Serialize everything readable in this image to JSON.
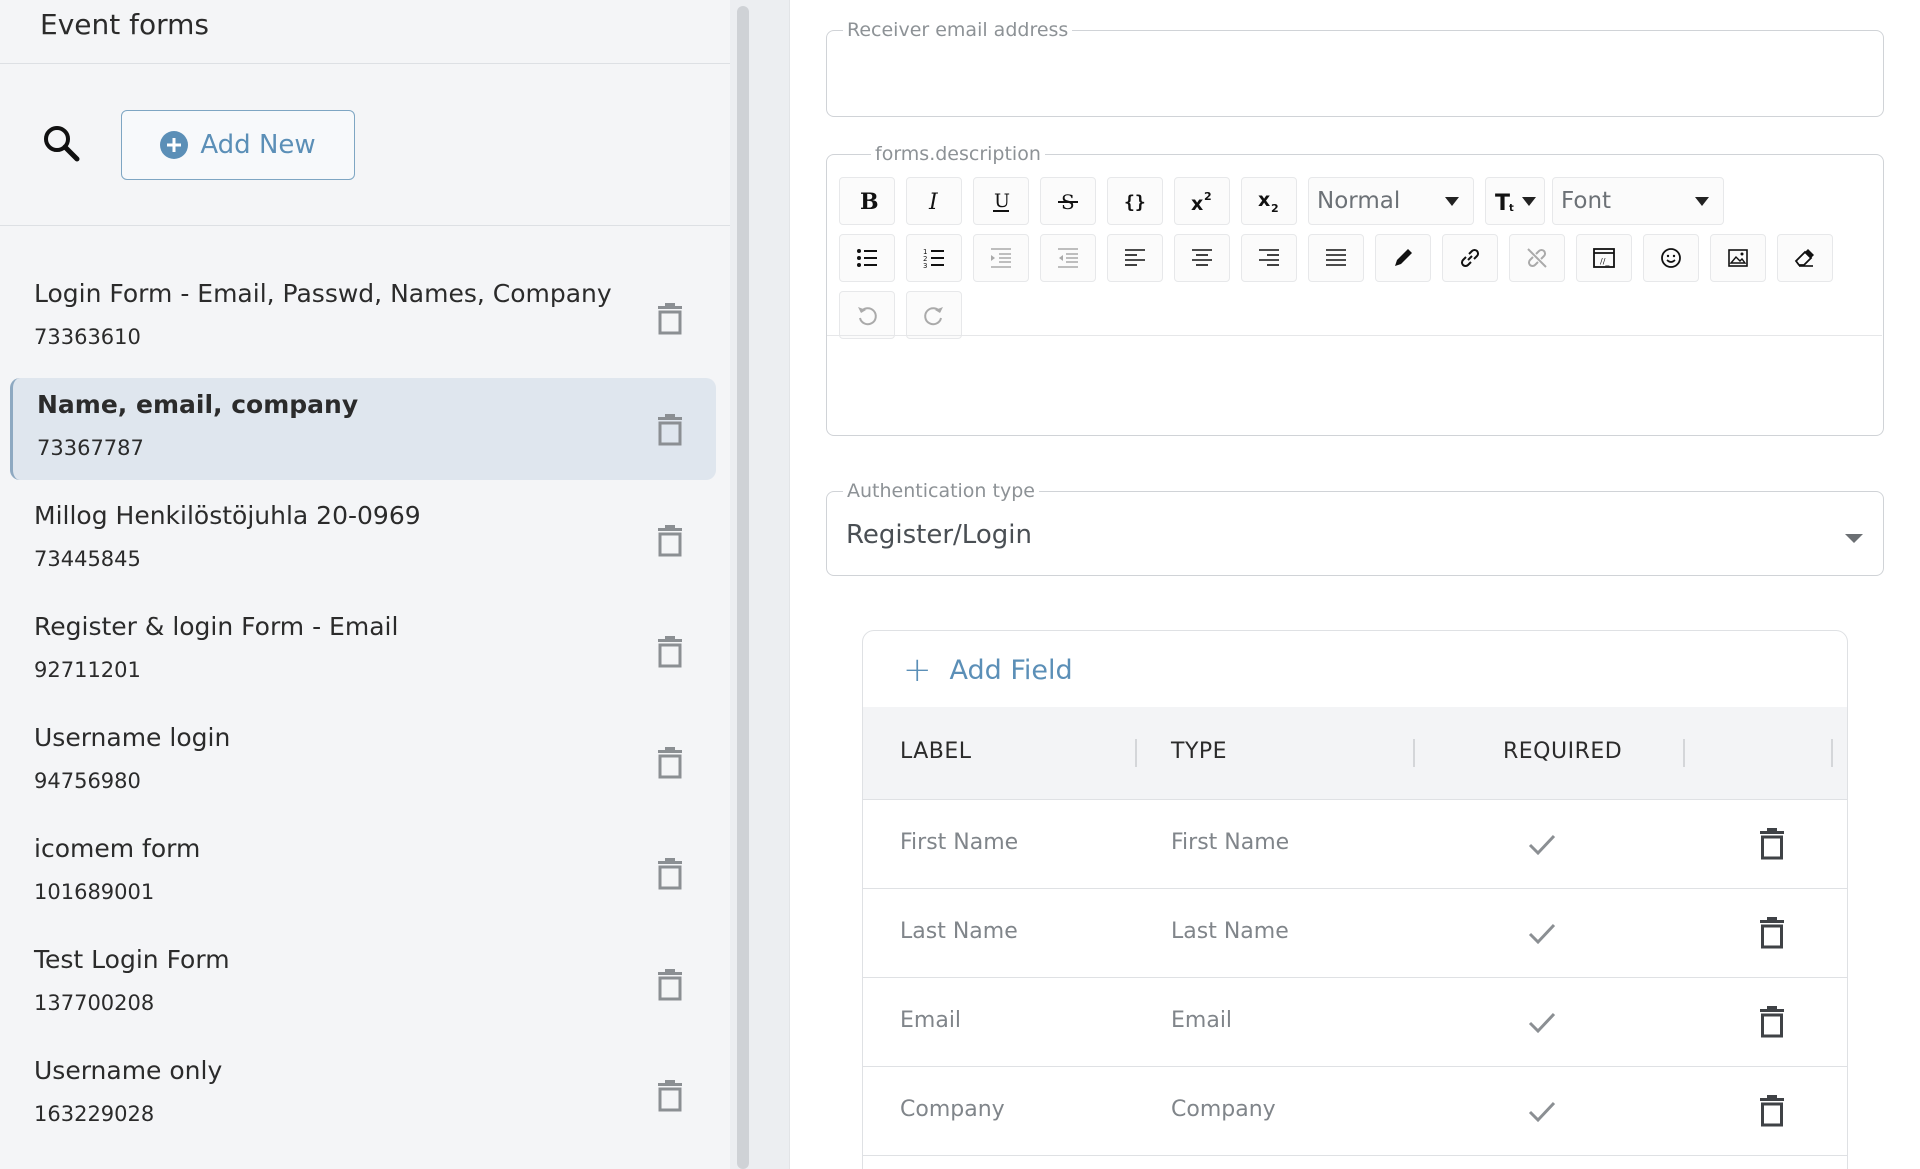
{
  "left_panel": {
    "title": "Event forms",
    "add_new_label": "Add New",
    "forms": [
      {
        "name": "Login Form - Email, Passwd, Names, Company",
        "id": "73363610",
        "selected": false
      },
      {
        "name": "Name, email, company",
        "id": "73367787",
        "selected": true
      },
      {
        "name": "Millog Henkilöstöjuhla 20-0969",
        "id": "73445845",
        "selected": false
      },
      {
        "name": "Register & login Form - Email",
        "id": "92711201",
        "selected": false
      },
      {
        "name": "Username login",
        "id": "94756980",
        "selected": false
      },
      {
        "name": "icomem form",
        "id": "101689001",
        "selected": false
      },
      {
        "name": "Test Login Form",
        "id": "137700208",
        "selected": false
      },
      {
        "name": "Username only",
        "id": "163229028",
        "selected": false
      }
    ]
  },
  "editor": {
    "receiver_email": {
      "label": "Receiver email address",
      "value": ""
    },
    "description": {
      "label": "forms.description",
      "block_format": "Normal",
      "font": "Font"
    },
    "auth_type": {
      "label": "Authentication type",
      "value": "Register/Login"
    }
  },
  "fields_table": {
    "add_field_label": "Add Field",
    "columns": [
      "LABEL",
      "TYPE",
      "REQUIRED"
    ],
    "rows": [
      {
        "label": "First Name",
        "type": "First Name",
        "required": true
      },
      {
        "label": "Last Name",
        "type": "Last Name",
        "required": true
      },
      {
        "label": "Email",
        "type": "Email",
        "required": true
      },
      {
        "label": "Company",
        "type": "Company",
        "required": true
      }
    ]
  },
  "colors": {
    "accent": "#5b8fb7",
    "selected_bg": "#dfe6ee",
    "panel_bg": "#f4f5f7"
  }
}
